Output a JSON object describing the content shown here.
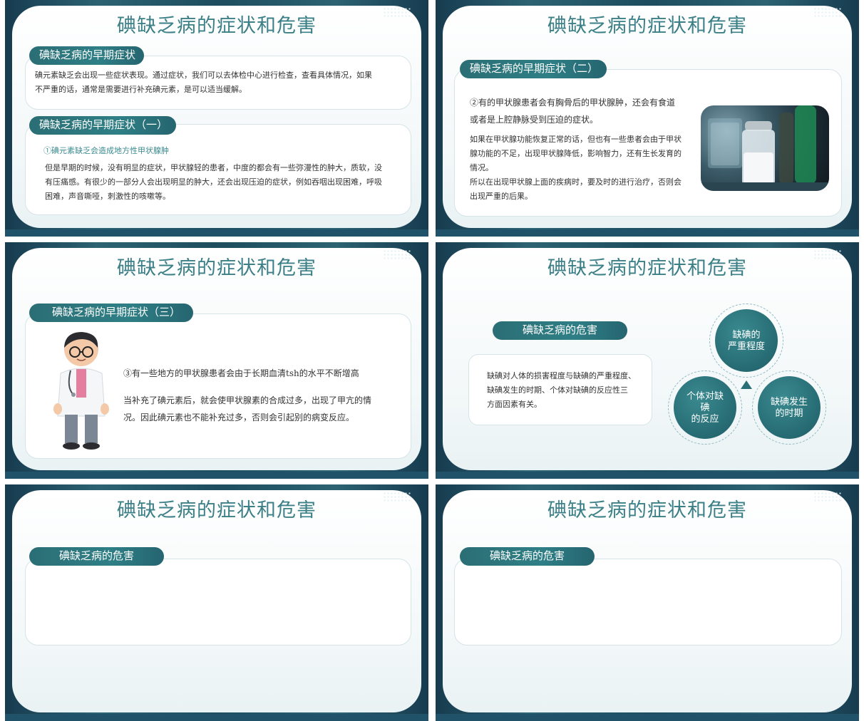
{
  "common_title": "碘缺乏病的症状和危害",
  "slide1": {
    "pill1": "碘缺乏病的早期症状",
    "text1": "碘元素缺乏会出现一些症状表现。通过症状，我们可以去体检中心进行检查，查看具体情况，如果",
    "text2": "不严重的话，通常是需要进行补充碘元素，是可以适当缓解。",
    "pill2": "碘缺乏病的早期症状（一）",
    "highlight": "①碘元素缺乏会造成地方性甲状腺肿",
    "p1": "但是早期的时候，没有明显的症状，甲状腺轻的患者，中度的都会有一些弥漫性的肿大，质软，没",
    "p2": "有压痛感。有很少的一部分人会出现明显的肿大，还会出现压迫的症状，例如吞咽出现困难，呼吸",
    "p3": "困难，声音嘶哑，刺激性的咳嗽等。"
  },
  "slide2": {
    "pill": "碘缺乏病的早期症状（二）",
    "a1": "②有的甲状腺患者会有胸骨后的甲状腺肿，还会有食道",
    "a2": "或者是上腔静脉受到压迫的症状。",
    "b1": "如果在甲状腺功能恢复正常的话，但也有一些患者会由于甲状",
    "b2": "腺功能的不足，出现甲状腺降低，影响智力，还有生长发育的",
    "b3": "情况。",
    "b4": "所以在出现甲状腺上面的疾病时，要及时的进行治疗，否则会",
    "b5": "出现严重的后果。"
  },
  "slide3": {
    "pill": "碘缺乏病的早期症状（三）",
    "line1": "③有一些地方的甲状腺患者会由于长期血清tsh的水平不断增高",
    "line2": "当补充了碘元素后，就会使甲状腺素的合成过多，出现了甲亢的情",
    "line3": "况。因此碘元素也不能补充过多，否则会引起别的病变反应。"
  },
  "slide4": {
    "pill": "碘缺乏病的危害",
    "t1": "缺碘对人体的损害程度与缺碘的严重程度、",
    "t2": "缺碘发生的时期、个体对缺碘的反应性三",
    "t3": "方面因素有关。",
    "c_top_1": "缺碘的",
    "c_top_2": "严重程度",
    "c_left_1": "个体对缺",
    "c_left_2": "碘",
    "c_left_3": "的反应",
    "c_right_1": "缺碘发生",
    "c_right_2": "的时期"
  },
  "slide5": {
    "pill": "碘缺乏病的危害"
  },
  "slide6": {
    "pill": "碘缺乏病的危害"
  }
}
